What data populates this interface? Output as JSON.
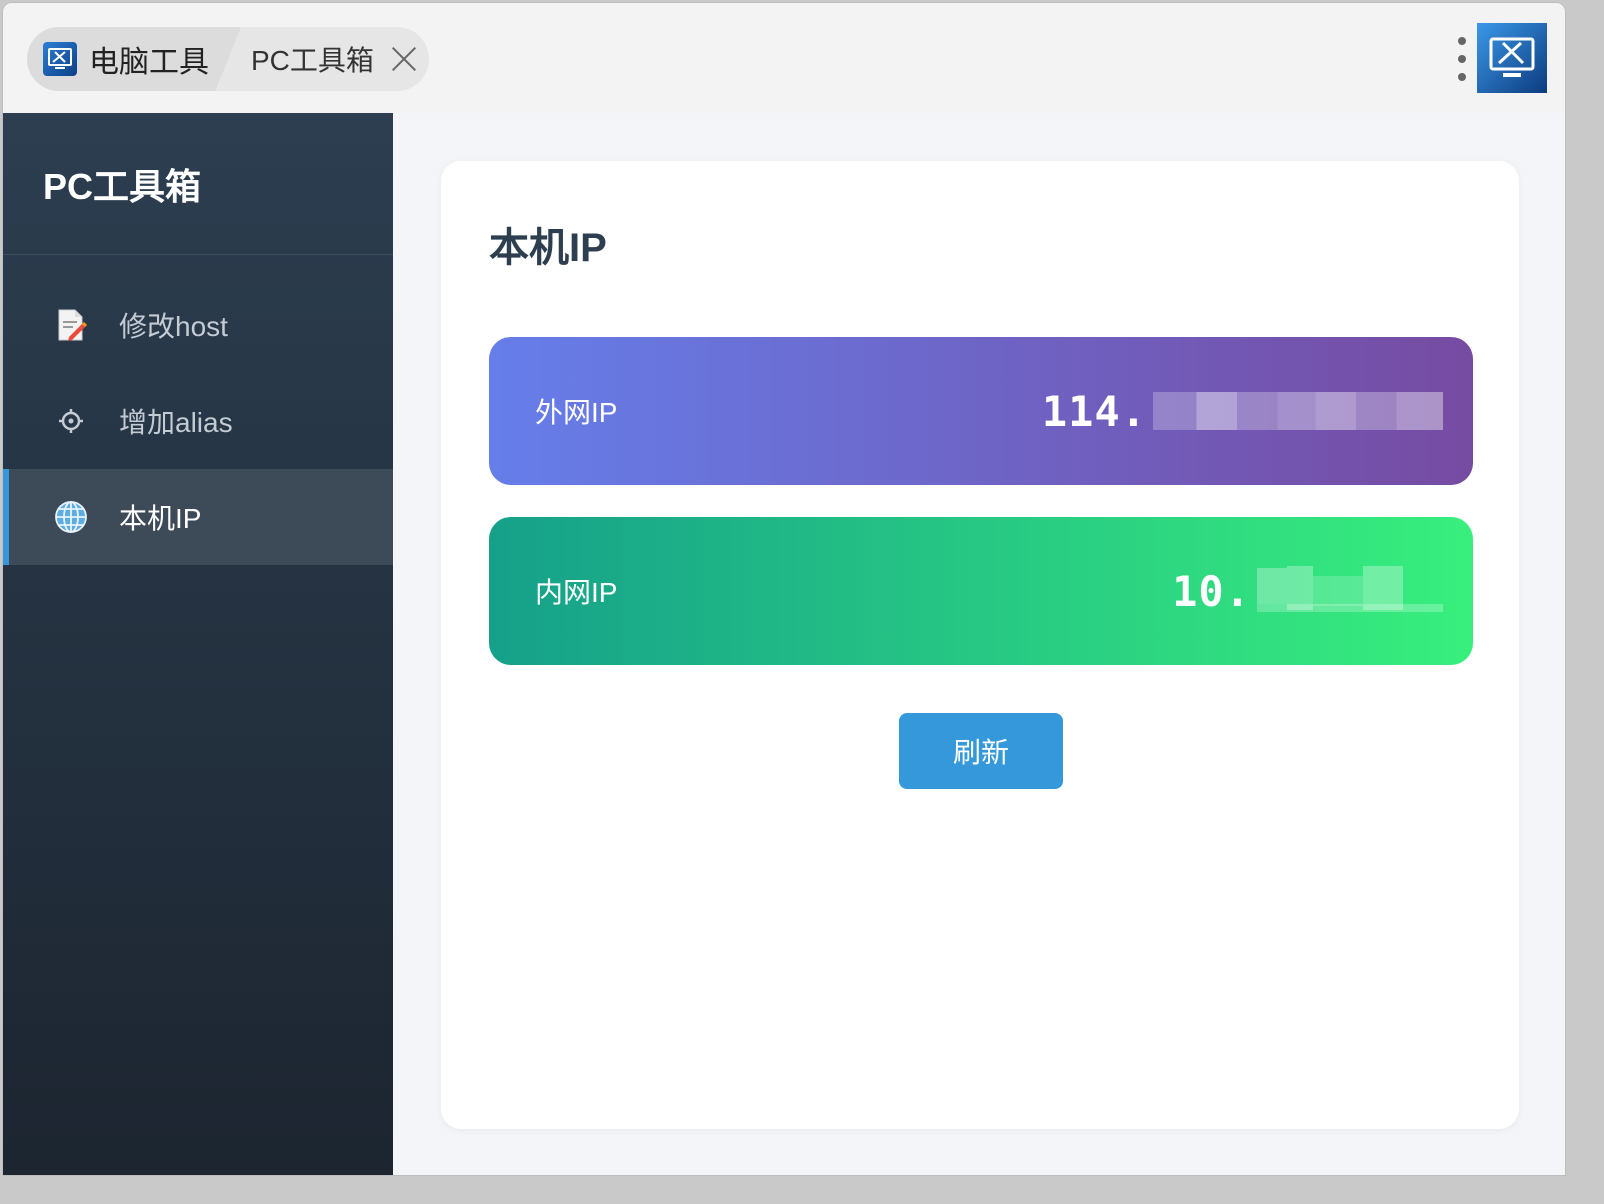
{
  "titlebar": {
    "app_tab_label": "电脑工具",
    "page_tab_label": "PC工具箱"
  },
  "sidebar": {
    "title": "PC工具箱",
    "items": [
      {
        "label": "修改host",
        "icon": "memo-icon",
        "active": false
      },
      {
        "label": "增加alias",
        "icon": "gear-icon",
        "active": false
      },
      {
        "label": "本机IP",
        "icon": "globe-icon",
        "active": true
      }
    ]
  },
  "main": {
    "title": "本机IP",
    "external": {
      "label": "外网IP",
      "value": "114."
    },
    "internal": {
      "label": "内网IP",
      "value": "10."
    },
    "refresh_label": "刷新"
  },
  "colors": {
    "accent": "#3498db",
    "sidebar_bg": "#2c3e50",
    "external_gradient": [
      "#667eea",
      "#764ba2"
    ],
    "internal_gradient": [
      "#16a08a",
      "#38ef7d"
    ]
  }
}
